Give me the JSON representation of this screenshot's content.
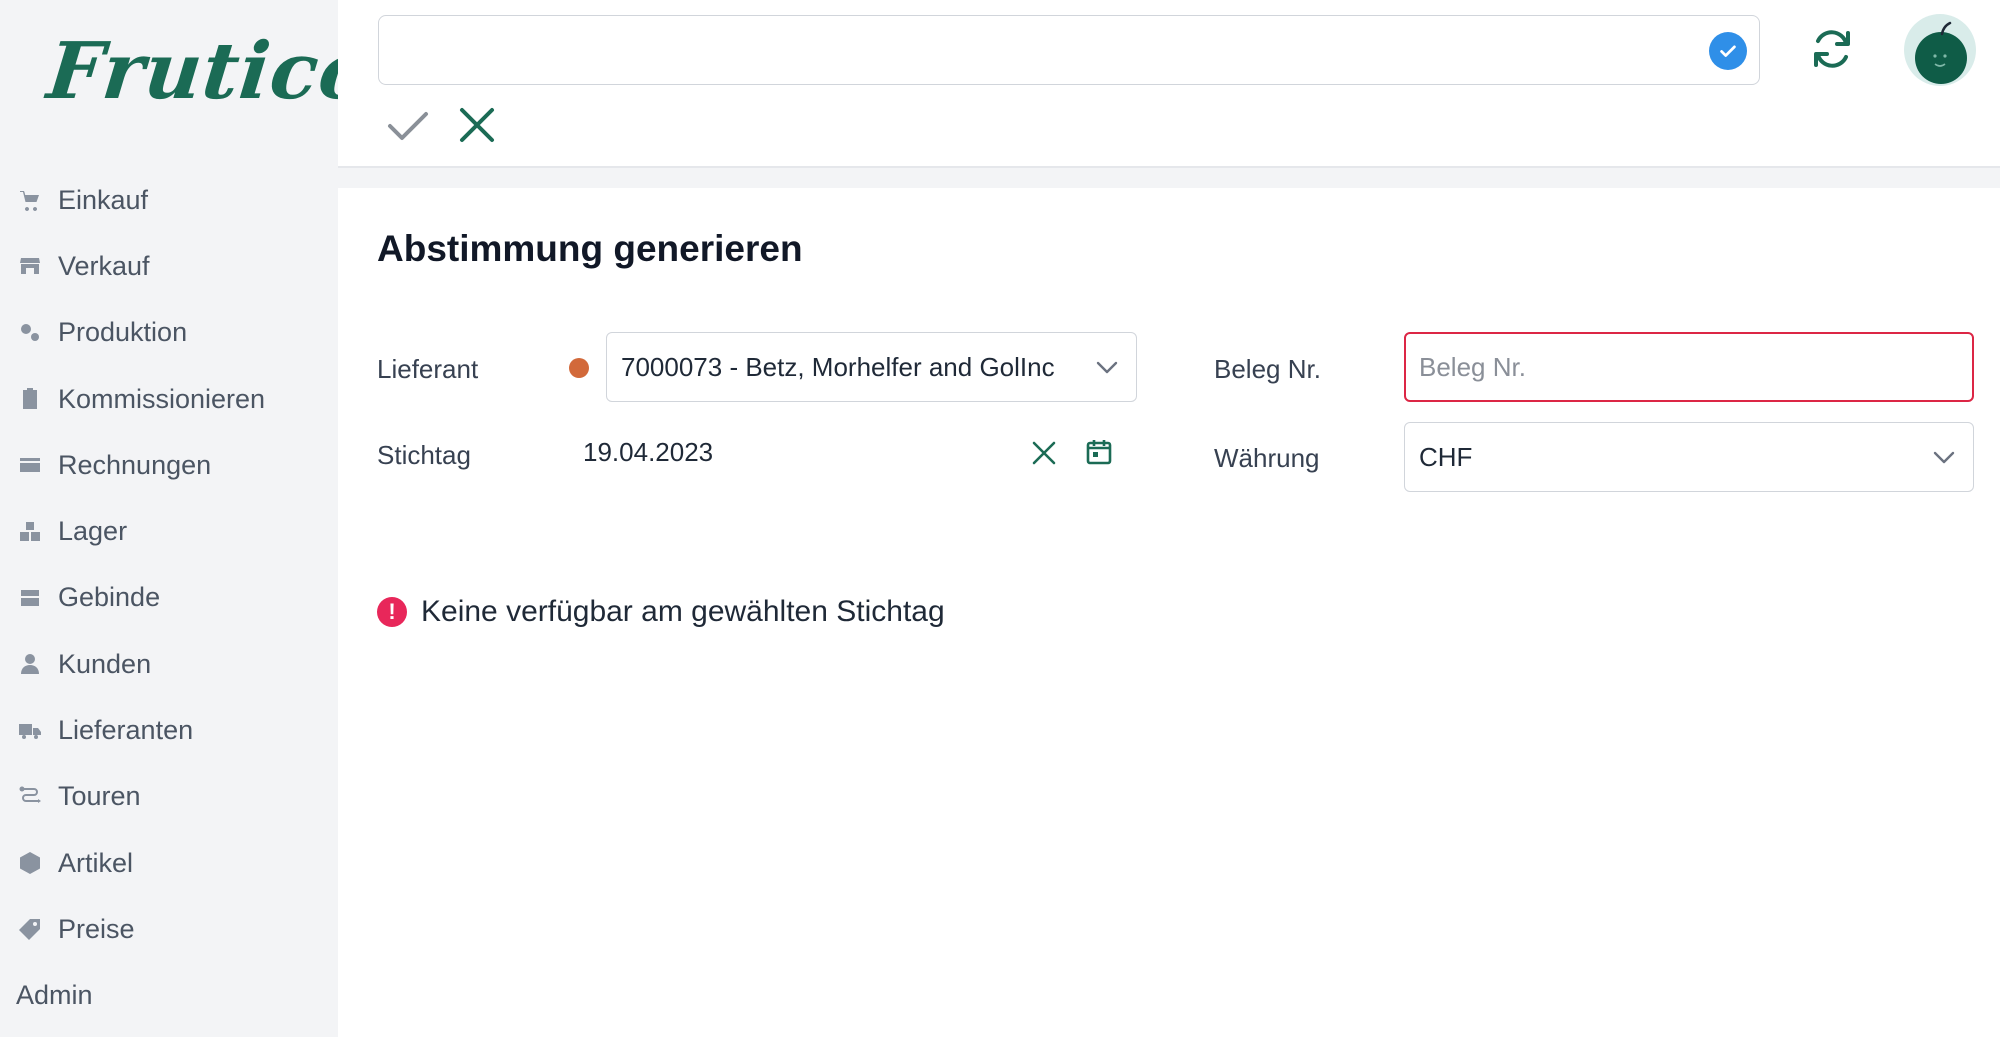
{
  "app": {
    "logo_text": "Frutico"
  },
  "sidebar": {
    "items": [
      {
        "label": "Einkauf",
        "icon": "cart-icon"
      },
      {
        "label": "Verkauf",
        "icon": "store-icon"
      },
      {
        "label": "Produktion",
        "icon": "gears-icon"
      },
      {
        "label": "Kommissionieren",
        "icon": "clipboard-icon"
      },
      {
        "label": "Rechnungen",
        "icon": "credit-card-icon"
      },
      {
        "label": "Lager",
        "icon": "boxes-icon"
      },
      {
        "label": "Gebinde",
        "icon": "crate-icon"
      },
      {
        "label": "Kunden",
        "icon": "user-icon"
      },
      {
        "label": "Lieferanten",
        "icon": "truck-icon"
      },
      {
        "label": "Touren",
        "icon": "route-icon"
      },
      {
        "label": "Artikel",
        "icon": "hexagon-icon"
      },
      {
        "label": "Preise",
        "icon": "tag-icon"
      }
    ],
    "admin_label": "Admin"
  },
  "topbar": {
    "search_value": ""
  },
  "page": {
    "title": "Abstimmung generieren",
    "lieferant_label": "Lieferant",
    "lieferant_value": "7000073 - Betz, Morhelfer and GolInc",
    "stichtag_label": "Stichtag",
    "stichtag_value": "19.04.2023",
    "beleg_label": "Beleg Nr.",
    "beleg_placeholder": "Beleg Nr.",
    "waehrung_label": "Währung",
    "waehrung_value": "CHF",
    "warning_text": "Keine verfügbar am gewählten Stichtag"
  },
  "colors": {
    "brand": "#1b6b55",
    "error": "#dc2645",
    "badge_blue": "#2f8fe8",
    "status_dot": "#d2693a"
  }
}
